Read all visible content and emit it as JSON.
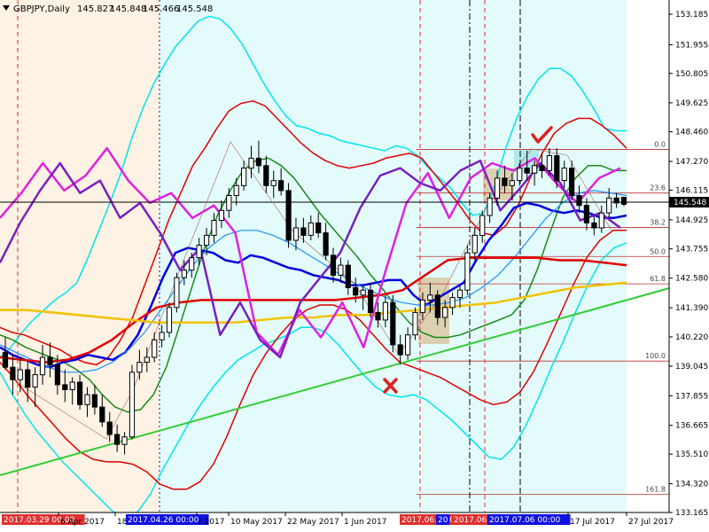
{
  "header": {
    "symbol": "GBPJPY,Daily",
    "open": "145.827",
    "high": "145.848",
    "low": "145.466",
    "close": "145.548"
  },
  "chart_data": {
    "type": "candlestick",
    "symbol": "GBPJPY",
    "timeframe": "Daily",
    "last_price": 145.548,
    "ylim": [
      133.165,
      153.185
    ],
    "y_ticks": [
      "153.185",
      "151.955",
      "150.805",
      "149.625",
      "148.460",
      "147.270",
      "146.115",
      "144.925",
      "143.755",
      "142.580",
      "141.390",
      "140.220",
      "139.045",
      "137.855",
      "136.665",
      "135.510",
      "134.320",
      "133.165"
    ],
    "x_ticks": [
      "2017.03.29 00:00",
      "6 Apr 2017",
      "18",
      "2017.04.26 00:00",
      "r 2017",
      "10 May 2017",
      "22 May 2017",
      "1 Jun 2017",
      "2017.06.16 00:00",
      "20",
      "2017.06.",
      "2017.07.06 00:00",
      "17 Jul 2017",
      "27 Jul 2017"
    ],
    "fibonacci_levels": [
      {
        "label": "0.0",
        "price": 147.75
      },
      {
        "label": "23.6",
        "price": 146.0
      },
      {
        "label": "38.2",
        "price": 144.62
      },
      {
        "label": "50.0",
        "price": 143.45
      },
      {
        "label": "61.8",
        "price": 142.35
      },
      {
        "label": "100.0",
        "price": 139.25
      },
      {
        "label": "161.8",
        "price": 133.9
      }
    ],
    "candles": [
      {
        "o": 139.6,
        "h": 140.2,
        "l": 138.9,
        "c": 139.0
      },
      {
        "o": 139.0,
        "h": 139.5,
        "l": 137.9,
        "c": 138.5
      },
      {
        "o": 138.5,
        "h": 139.4,
        "l": 138.0,
        "c": 138.9
      },
      {
        "o": 138.9,
        "h": 139.2,
        "l": 137.6,
        "c": 138.2
      },
      {
        "o": 138.2,
        "h": 139.0,
        "l": 137.4,
        "c": 138.7
      },
      {
        "o": 138.7,
        "h": 139.9,
        "l": 138.3,
        "c": 139.4
      },
      {
        "o": 139.4,
        "h": 140.0,
        "l": 138.6,
        "c": 139.1
      },
      {
        "o": 139.1,
        "h": 139.5,
        "l": 137.9,
        "c": 138.3
      },
      {
        "o": 138.3,
        "h": 138.9,
        "l": 137.6,
        "c": 138.1
      },
      {
        "o": 138.1,
        "h": 138.6,
        "l": 137.5,
        "c": 138.4
      },
      {
        "o": 138.4,
        "h": 138.7,
        "l": 137.3,
        "c": 137.5
      },
      {
        "o": 137.5,
        "h": 138.2,
        "l": 137.0,
        "c": 137.9
      },
      {
        "o": 137.9,
        "h": 138.3,
        "l": 137.1,
        "c": 137.4
      },
      {
        "o": 137.4,
        "h": 137.9,
        "l": 136.6,
        "c": 136.8
      },
      {
        "o": 136.8,
        "h": 137.2,
        "l": 136.0,
        "c": 136.3
      },
      {
        "o": 136.3,
        "h": 136.7,
        "l": 135.6,
        "c": 135.9
      },
      {
        "o": 135.9,
        "h": 136.4,
        "l": 135.5,
        "c": 136.2
      },
      {
        "o": 136.2,
        "h": 139.1,
        "l": 136.1,
        "c": 138.8
      },
      {
        "o": 138.8,
        "h": 139.7,
        "l": 138.5,
        "c": 139.2
      },
      {
        "o": 139.2,
        "h": 139.8,
        "l": 138.8,
        "c": 139.4
      },
      {
        "o": 139.4,
        "h": 140.4,
        "l": 139.2,
        "c": 140.1
      },
      {
        "o": 140.1,
        "h": 140.7,
        "l": 139.8,
        "c": 140.4
      },
      {
        "o": 140.4,
        "h": 141.6,
        "l": 140.2,
        "c": 141.4
      },
      {
        "o": 141.4,
        "h": 142.8,
        "l": 141.2,
        "c": 142.6
      },
      {
        "o": 142.6,
        "h": 143.3,
        "l": 142.3,
        "c": 142.9
      },
      {
        "o": 142.9,
        "h": 143.6,
        "l": 142.6,
        "c": 143.4
      },
      {
        "o": 143.4,
        "h": 144.2,
        "l": 143.1,
        "c": 143.9
      },
      {
        "o": 143.9,
        "h": 144.6,
        "l": 143.5,
        "c": 144.3
      },
      {
        "o": 144.3,
        "h": 145.2,
        "l": 144.0,
        "c": 144.9
      },
      {
        "o": 144.9,
        "h": 145.7,
        "l": 144.6,
        "c": 145.3
      },
      {
        "o": 145.3,
        "h": 146.2,
        "l": 145.0,
        "c": 145.9
      },
      {
        "o": 145.9,
        "h": 146.6,
        "l": 145.5,
        "c": 146.3
      },
      {
        "o": 146.3,
        "h": 147.3,
        "l": 146.1,
        "c": 147.0
      },
      {
        "o": 147.0,
        "h": 147.9,
        "l": 146.6,
        "c": 147.4
      },
      {
        "o": 147.4,
        "h": 148.1,
        "l": 146.8,
        "c": 147.1
      },
      {
        "o": 147.1,
        "h": 147.5,
        "l": 146.0,
        "c": 146.3
      },
      {
        "o": 146.3,
        "h": 146.9,
        "l": 145.8,
        "c": 146.5
      },
      {
        "o": 146.5,
        "h": 147.0,
        "l": 145.9,
        "c": 146.1
      },
      {
        "o": 146.1,
        "h": 146.4,
        "l": 143.8,
        "c": 144.1
      },
      {
        "o": 144.1,
        "h": 145.0,
        "l": 143.7,
        "c": 144.6
      },
      {
        "o": 144.6,
        "h": 145.0,
        "l": 144.0,
        "c": 144.3
      },
      {
        "o": 144.3,
        "h": 145.1,
        "l": 144.1,
        "c": 144.8
      },
      {
        "o": 144.8,
        "h": 145.2,
        "l": 144.2,
        "c": 144.4
      },
      {
        "o": 144.4,
        "h": 144.8,
        "l": 143.3,
        "c": 143.5
      },
      {
        "o": 143.5,
        "h": 143.8,
        "l": 142.4,
        "c": 142.7
      },
      {
        "o": 142.7,
        "h": 143.4,
        "l": 142.4,
        "c": 143.1
      },
      {
        "o": 143.1,
        "h": 143.3,
        "l": 141.9,
        "c": 142.2
      },
      {
        "o": 142.2,
        "h": 142.6,
        "l": 141.6,
        "c": 141.9
      },
      {
        "o": 141.9,
        "h": 142.3,
        "l": 141.3,
        "c": 142.1
      },
      {
        "o": 142.1,
        "h": 142.4,
        "l": 141.0,
        "c": 141.2
      },
      {
        "o": 141.2,
        "h": 141.6,
        "l": 140.6,
        "c": 140.9
      },
      {
        "o": 140.9,
        "h": 141.9,
        "l": 140.6,
        "c": 141.6
      },
      {
        "o": 141.6,
        "h": 141.9,
        "l": 139.6,
        "c": 139.9
      },
      {
        "o": 139.9,
        "h": 140.3,
        "l": 139.1,
        "c": 139.5
      },
      {
        "o": 139.5,
        "h": 140.6,
        "l": 139.3,
        "c": 140.3
      },
      {
        "o": 140.3,
        "h": 141.4,
        "l": 140.1,
        "c": 141.2
      },
      {
        "o": 141.2,
        "h": 142.0,
        "l": 140.9,
        "c": 141.7
      },
      {
        "o": 141.7,
        "h": 142.4,
        "l": 141.2,
        "c": 141.9
      },
      {
        "o": 141.9,
        "h": 142.1,
        "l": 140.7,
        "c": 141.0
      },
      {
        "o": 141.0,
        "h": 141.7,
        "l": 140.6,
        "c": 141.4
      },
      {
        "o": 141.4,
        "h": 142.0,
        "l": 141.1,
        "c": 141.8
      },
      {
        "o": 141.8,
        "h": 142.3,
        "l": 141.4,
        "c": 142.1
      },
      {
        "o": 142.1,
        "h": 143.9,
        "l": 141.9,
        "c": 143.6
      },
      {
        "o": 143.6,
        "h": 144.6,
        "l": 143.3,
        "c": 144.3
      },
      {
        "o": 144.3,
        "h": 145.3,
        "l": 144.0,
        "c": 145.1
      },
      {
        "o": 145.1,
        "h": 146.0,
        "l": 144.8,
        "c": 145.8
      },
      {
        "o": 145.8,
        "h": 146.9,
        "l": 145.5,
        "c": 146.6
      },
      {
        "o": 146.6,
        "h": 147.1,
        "l": 146.0,
        "c": 146.3
      },
      {
        "o": 146.3,
        "h": 146.8,
        "l": 145.7,
        "c": 146.5
      },
      {
        "o": 146.5,
        "h": 147.2,
        "l": 146.3,
        "c": 147.0
      },
      {
        "o": 147.0,
        "h": 147.7,
        "l": 146.5,
        "c": 146.8
      },
      {
        "o": 146.8,
        "h": 147.3,
        "l": 146.3,
        "c": 147.1
      },
      {
        "o": 147.1,
        "h": 147.6,
        "l": 146.6,
        "c": 146.9
      },
      {
        "o": 146.9,
        "h": 147.8,
        "l": 146.7,
        "c": 147.5
      },
      {
        "o": 147.5,
        "h": 147.8,
        "l": 146.2,
        "c": 146.5
      },
      {
        "o": 146.5,
        "h": 147.3,
        "l": 146.2,
        "c": 147.0
      },
      {
        "o": 147.0,
        "h": 147.3,
        "l": 145.7,
        "c": 145.9
      },
      {
        "o": 145.9,
        "h": 146.3,
        "l": 145.2,
        "c": 145.5
      },
      {
        "o": 145.5,
        "h": 145.8,
        "l": 144.5,
        "c": 144.8
      },
      {
        "o": 144.8,
        "h": 145.1,
        "l": 144.3,
        "c": 144.6
      },
      {
        "o": 144.6,
        "h": 145.5,
        "l": 144.4,
        "c": 145.2
      },
      {
        "o": 145.2,
        "h": 146.2,
        "l": 145.0,
        "c": 145.8
      },
      {
        "o": 145.8,
        "h": 146.0,
        "l": 145.4,
        "c": 145.6
      },
      {
        "o": 145.827,
        "h": 145.848,
        "l": 145.466,
        "c": 145.548
      }
    ],
    "indicator_lines": [
      {
        "name": "bb-outer-upper",
        "color": "#00e5ee",
        "width": 1.5,
        "values": [
          139.4,
          139.8,
          140.4,
          140.9,
          141.3,
          141.7,
          142.0,
          142.4,
          143.4,
          144.5,
          145.6,
          146.8,
          148.2,
          149.4,
          150.4,
          151.2,
          151.9,
          152.4,
          152.9,
          153.1,
          153.0,
          152.6,
          152.0,
          151.2,
          150.4,
          149.7,
          149.1,
          148.7,
          148.6,
          148.4,
          148.3,
          148.1,
          148.0,
          147.9,
          147.8,
          147.7,
          147.9,
          147.8,
          147.5,
          147.0,
          146.6,
          146.2,
          145.6,
          145.1,
          145.2,
          146.3,
          147.8,
          149.0,
          149.9,
          150.6,
          151.0,
          151.0,
          150.7,
          150.1,
          149.4,
          148.6,
          148.5,
          148.5
        ]
      },
      {
        "name": "bb-outer-lower",
        "color": "#00e5ee",
        "width": 1.5,
        "values": [
          138.8,
          137.9,
          137.1,
          136.4,
          135.8,
          135.2,
          134.7,
          134.2,
          133.7,
          133.2,
          133.0,
          133.2,
          133.9,
          134.9,
          135.8,
          136.7,
          137.5,
          138.2,
          138.8,
          139.3,
          139.6,
          139.9,
          140.1,
          140.3,
          140.6,
          140.6,
          140.4,
          139.9,
          139.3,
          138.7,
          138.2,
          137.9,
          137.8,
          137.9,
          137.7,
          137.3,
          136.9,
          136.4,
          135.9,
          135.4,
          135.3,
          135.8,
          136.7,
          137.8,
          139.0,
          140.1,
          141.3,
          142.4,
          143.3,
          143.8,
          144.0
        ]
      },
      {
        "name": "bb-upper-red",
        "color": "#e00000",
        "width": 1.5,
        "values": [
          140.6,
          140.4,
          140.3,
          140.1,
          139.9,
          139.7,
          139.4,
          139.2,
          139.1,
          139.4,
          140.1,
          141.0,
          142.3,
          143.6,
          144.9,
          146.0,
          147.1,
          147.8,
          148.6,
          149.3,
          149.6,
          149.7,
          149.5,
          149.0,
          148.5,
          148.0,
          147.6,
          147.3,
          147.1,
          147.0,
          147.1,
          147.2,
          147.4,
          147.5,
          147.6,
          147.4,
          146.8,
          146.2,
          145.6,
          144.9,
          144.4,
          144.3,
          144.7,
          145.5,
          146.6,
          147.6,
          148.4,
          148.8,
          149.0,
          149.0,
          148.7,
          148.3,
          147.8
        ]
      },
      {
        "name": "bb-lower-red",
        "color": "#e00000",
        "width": 1.5,
        "values": [
          139.2,
          138.6,
          137.9,
          137.3,
          136.7,
          136.1,
          135.6,
          135.3,
          135.2,
          135.2,
          135.1,
          134.8,
          134.3,
          134.1,
          134.1,
          134.4,
          135.1,
          136.2,
          137.5,
          138.7,
          139.6,
          140.3,
          140.9,
          141.3,
          141.5,
          141.5,
          141.3,
          140.9,
          140.3,
          139.7,
          139.2,
          139.0,
          138.8,
          138.6,
          138.3,
          138.0,
          137.7,
          137.5,
          137.6,
          138.0,
          138.8,
          139.9,
          141.1,
          142.3,
          143.4,
          144.1,
          144.5,
          144.5
        ]
      },
      {
        "name": "bb-mid-green",
        "color": "#1a8a1a",
        "width": 1.5,
        "values": [
          140.3,
          140.1,
          139.8,
          139.6,
          139.4,
          139.2,
          138.9,
          138.5,
          137.9,
          137.4,
          137.2,
          137.3,
          137.9,
          139.0,
          140.6,
          142.2,
          143.8,
          145.1,
          146.1,
          146.9,
          147.3,
          147.4,
          147.1,
          146.6,
          145.9,
          145.2,
          144.6,
          144.0,
          143.4,
          142.7,
          142.1,
          141.4,
          140.8,
          140.4,
          140.2,
          140.2,
          140.3,
          140.5,
          140.7,
          140.9,
          141.1,
          141.7,
          142.9,
          144.4,
          145.8,
          146.6,
          147.1,
          147.1,
          146.9,
          146.9
        ]
      },
      {
        "name": "ma-blue-thick",
        "color": "#0000e0",
        "width": 2.5,
        "values": [
          139.8,
          139.5,
          139.3,
          139.1,
          139.0,
          139.2,
          139.3,
          139.5,
          139.4,
          139.3,
          139.6,
          140.3,
          141.4,
          142.6,
          143.6,
          143.8,
          143.7,
          143.6,
          143.3,
          143.2,
          143.5,
          143.4,
          143.2,
          143.0,
          142.9,
          142.7,
          142.6,
          142.5,
          142.3,
          142.3,
          142.4,
          142.5,
          142.5,
          141.9,
          141.5,
          141.8,
          142.1,
          142.4,
          143.3,
          144.1,
          144.7,
          145.4,
          145.6,
          145.5,
          145.3,
          145.2,
          145.3,
          145.2,
          145.0,
          145.0,
          145.1
        ]
      },
      {
        "name": "ma-lightblue",
        "color": "#1e90ff",
        "width": 1.2,
        "values": [
          139.9,
          139.6,
          139.3,
          139.0,
          138.8,
          138.8,
          138.9,
          139.2,
          139.7,
          140.4,
          141.3,
          142.2,
          143.1,
          143.8,
          144.3,
          144.5,
          144.5,
          144.3,
          144.0,
          143.6,
          143.2,
          142.8,
          142.4,
          142.1,
          141.8,
          141.6,
          141.5,
          141.5,
          141.6,
          141.8,
          142.2,
          142.7,
          143.4,
          144.2,
          145.0,
          145.6,
          146.0,
          146.1,
          146.0,
          145.9
        ]
      },
      {
        "name": "ma-red-flat",
        "color": "#e00000",
        "width": 2.5,
        "values": [
          139.4,
          139.3,
          139.2,
          139.3,
          139.6,
          140.1,
          140.8,
          141.4,
          141.6,
          141.7,
          141.7,
          141.7,
          141.7,
          141.7,
          141.7,
          141.7,
          141.8,
          141.9,
          142.1,
          142.7,
          143.3,
          143.4,
          143.4,
          143.4,
          143.4,
          143.3,
          143.3,
          143.2,
          143.1
        ]
      },
      {
        "name": "ma-gold",
        "color": "#f2c200",
        "width": 2.5,
        "values": [
          141.3,
          141.3,
          141.2,
          141.1,
          141.0,
          140.9,
          140.8,
          140.8,
          140.8,
          140.8,
          140.9,
          141.0,
          141.0,
          141.1,
          141.1,
          141.2,
          141.3,
          141.4,
          141.5,
          141.6,
          141.8,
          142.0,
          142.2,
          142.3,
          142.4
        ]
      },
      {
        "name": "osc-magenta",
        "color": "#e020e0",
        "width": 2.5,
        "values": [
          145.0,
          146.0,
          147.2,
          146.1,
          146.7,
          147.8,
          146.5,
          145.6,
          146.0,
          145.0,
          145.5,
          144.4,
          140.4,
          139.5,
          141.3,
          140.2,
          141.6,
          139.8,
          142.8,
          145.6,
          146.8,
          145.0,
          146.6,
          147.2,
          146.9,
          147.4,
          146.4,
          145.6,
          146.6,
          147.0
        ]
      },
      {
        "name": "osc-purple",
        "color": "#7a1fbf",
        "width": 2.5,
        "values": [
          143.2,
          144.8,
          146.1,
          147.2,
          146.0,
          146.5,
          145.0,
          145.6,
          144.4,
          142.9,
          143.8,
          140.3,
          141.6,
          140.1,
          139.4,
          141.6,
          142.6,
          143.6,
          145.4,
          146.7,
          147.0,
          146.4,
          146.1,
          146.9,
          147.3,
          145.3,
          146.2,
          147.2,
          146.4,
          144.9,
          145.2,
          144.6
        ]
      }
    ]
  },
  "price_tag": {
    "value": "145.548",
    "color": "#000000"
  },
  "date_tags": [
    {
      "text": "2017.03.29 00:00",
      "color": "#e03030"
    },
    {
      "text": "2017.04.26 00:00",
      "color": "#1010e0"
    },
    {
      "text": "2017.06.16 00:00",
      "color": "#e03030"
    },
    {
      "text": "20",
      "color": "#1010e0"
    },
    {
      "text": "2017.06.",
      "color": "#e03030"
    },
    {
      "text": "2017.07.06 00:00",
      "color": "#1010e0"
    }
  ]
}
